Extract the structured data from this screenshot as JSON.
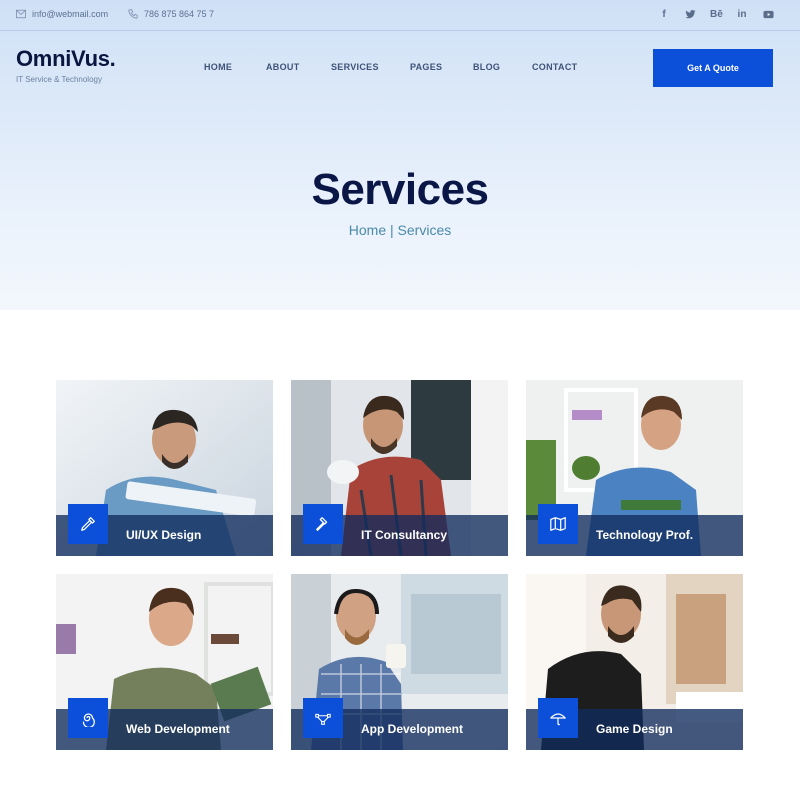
{
  "topbar": {
    "email": "info@webmail.com",
    "phone": "786 875 864 75 7",
    "social": [
      "facebook-icon",
      "twitter-icon",
      "behance-icon",
      "linkedin-icon",
      "youtube-icon"
    ],
    "behance_text": "Bē",
    "linkedin_text": "in"
  },
  "header": {
    "logo": "OmniVus.",
    "tagline": "IT Service & Technology",
    "nav": [
      "HOME",
      "ABOUT",
      "SERVICES",
      "PAGES",
      "BLOG",
      "CONTACT"
    ],
    "cta": "Get A Quote"
  },
  "hero": {
    "title": "Services",
    "breadcrumb_home": "Home",
    "breadcrumb_sep": "|",
    "breadcrumb_current": "Services"
  },
  "services": [
    {
      "title": "UI/UX Design",
      "icon": "eyedropper-icon"
    },
    {
      "title": "IT Consultancy",
      "icon": "hammer-icon"
    },
    {
      "title": "Technology Prof.",
      "icon": "map-icon"
    },
    {
      "title": "Web Development",
      "icon": "spiral-icon"
    },
    {
      "title": "App Development",
      "icon": "vector-path-icon"
    },
    {
      "title": "Game Design",
      "icon": "umbrella-icon"
    }
  ],
  "colors": {
    "accent": "#0c4fd8",
    "heading": "#0a1646",
    "breadcrumb": "#4b8aa8",
    "caption_overlay": "#112c5c"
  }
}
